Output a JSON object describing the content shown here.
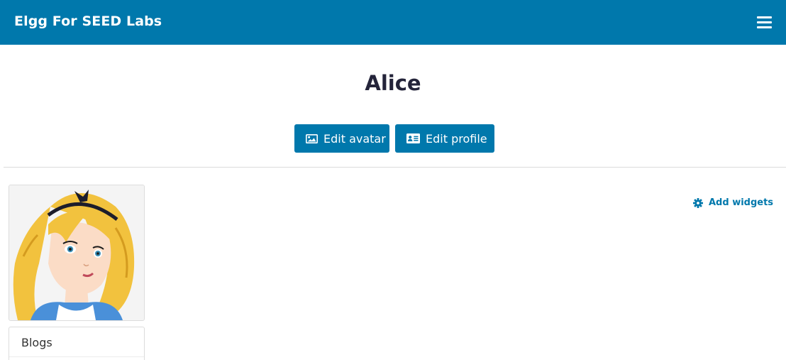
{
  "header": {
    "site_title": "Elgg For SEED Labs",
    "menu_icon": "hamburger-menu-icon",
    "background_color": "#0078ac"
  },
  "profile": {
    "name": "Alice",
    "actions": {
      "edit_avatar_label": "Edit avatar",
      "edit_avatar_icon": "image-icon",
      "edit_profile_label": "Edit profile",
      "edit_profile_icon": "id-card-icon"
    },
    "avatar_alt": "Alice"
  },
  "owner_menu": {
    "items": [
      {
        "label": "Blogs"
      }
    ]
  },
  "widgets": {
    "add_label": "Add widgets",
    "add_icon": "gear-icon"
  }
}
